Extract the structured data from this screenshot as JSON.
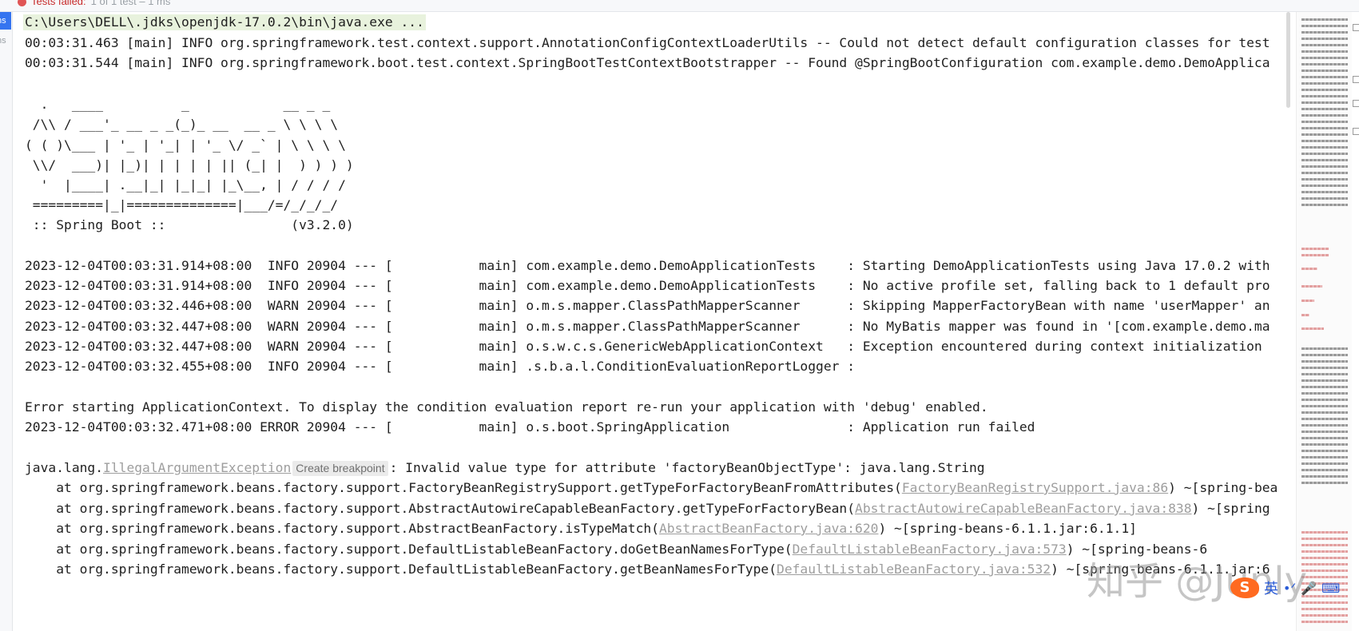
{
  "run": {
    "status_text": "Tests failed:",
    "status_sub": "1 of 1 test – 1 ms"
  },
  "gutter": {
    "active_tab": "ns",
    "inactive_tab": "ns"
  },
  "console": {
    "command_line": "C:\\Users\\DELL\\.jdks\\openjdk-17.0.2\\bin\\java.exe ...",
    "log_lines": [
      "00:03:31.463 [main] INFO org.springframework.test.context.support.AnnotationConfigContextLoaderUtils -- Could not detect default configuration classes for test",
      "00:03:31.544 [main] INFO org.springframework.boot.test.context.SpringBootTestContextBootstrapper -- Found @SpringBootConfiguration com.example.demo.DemoApplica"
    ],
    "banner": [
      "  .   ____          _            __ _ _",
      " /\\\\ / ___'_ __ _ _(_)_ __  __ _ \\ \\ \\ \\",
      "( ( )\\___ | '_ | '_| | '_ \\/ _` | \\ \\ \\ \\",
      " \\\\/  ___)| |_)| | | | | || (_| |  ) ) ) )",
      "  '  |____| .__|_| |_|_| |_\\__, | / / / /",
      " =========|_|==============|___/=/_/_/_/",
      " :: Spring Boot ::                (v3.2.0)"
    ],
    "app_logs": [
      "2023-12-04T00:03:31.914+08:00  INFO 20904 --- [           main] com.example.demo.DemoApplicationTests    : Starting DemoApplicationTests using Java 17.0.2 with",
      "2023-12-04T00:03:31.914+08:00  INFO 20904 --- [           main] com.example.demo.DemoApplicationTests    : No active profile set, falling back to 1 default pro",
      "2023-12-04T00:03:32.446+08:00  WARN 20904 --- [           main] o.m.s.mapper.ClassPathMapperScanner      : Skipping MapperFactoryBean with name 'userMapper' an",
      "2023-12-04T00:03:32.447+08:00  WARN 20904 --- [           main] o.m.s.mapper.ClassPathMapperScanner      : No MyBatis mapper was found in '[com.example.demo.ma",
      "2023-12-04T00:03:32.447+08:00  WARN 20904 --- [           main] o.s.w.c.s.GenericWebApplicationContext   : Exception encountered during context initialization",
      "2023-12-04T00:03:32.455+08:00  INFO 20904 --- [           main] .s.b.a.l.ConditionEvaluationReportLogger :"
    ],
    "error_message": "Error starting ApplicationContext. To display the condition evaluation report re-run your application with 'debug' enabled.",
    "error_log": "2023-12-04T00:03:32.471+08:00 ERROR 20904 --- [           main] o.s.boot.SpringApplication               : Application run failed",
    "exception": {
      "prefix": "java.lang.",
      "class_link": "IllegalArgumentException",
      "hint": "Create breakpoint",
      "message": ": Invalid value type for attribute 'factoryBeanObjectType': java.lang.String"
    },
    "stack": [
      {
        "pre": "    at org.springframework.beans.factory.support.FactoryBeanRegistrySupport.getTypeForFactoryBeanFromAttributes(",
        "link": "FactoryBeanRegistrySupport.java:86",
        "post": ") ~[spring-bea"
      },
      {
        "pre": "    at org.springframework.beans.factory.support.AbstractAutowireCapableBeanFactory.getTypeForFactoryBean(",
        "link": "AbstractAutowireCapableBeanFactory.java:838",
        "post": ") ~[spring"
      },
      {
        "pre": "    at org.springframework.beans.factory.support.AbstractBeanFactory.isTypeMatch(",
        "link": "AbstractBeanFactory.java:620",
        "post": ") ~[spring-beans-6.1.1.jar:6.1.1]"
      },
      {
        "pre": "    at org.springframework.beans.factory.support.DefaultListableBeanFactory.doGetBeanNamesForType(",
        "link": "DefaultListableBeanFactory.java:573",
        "post": ") ~[spring-beans-6"
      },
      {
        "pre": "    at org.springframework.beans.factory.support.DefaultListableBeanFactory.getBeanNamesForType(",
        "link": "DefaultListableBeanFactory.java:532",
        "post": ") ~[spring-beans-6.1.1.jar:6"
      }
    ]
  },
  "watermark": "知乎 @Junly",
  "ime": {
    "logo": "S",
    "lang": "英"
  },
  "colors": {
    "link": "#9e9e9e",
    "cmd_highlight": "#e8f2dd",
    "error_status": "#c62828"
  }
}
